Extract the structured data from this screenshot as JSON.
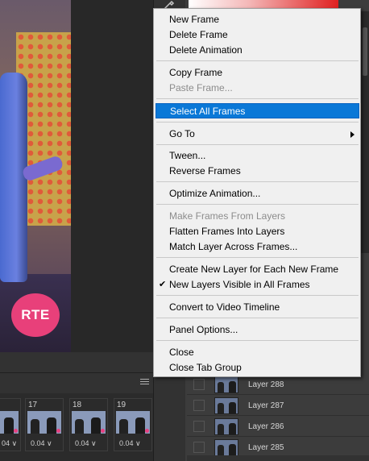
{
  "menu": {
    "items": [
      {
        "label": "New Frame"
      },
      {
        "label": "Delete Frame"
      },
      {
        "label": "Delete Animation"
      },
      {
        "label": "Copy Frame"
      },
      {
        "label": "Paste Frame..."
      },
      {
        "label": "Select All Frames"
      },
      {
        "label": "Go To"
      },
      {
        "label": "Tween..."
      },
      {
        "label": "Reverse Frames"
      },
      {
        "label": "Optimize Animation..."
      },
      {
        "label": "Make Frames From Layers"
      },
      {
        "label": "Flatten Frames Into Layers"
      },
      {
        "label": "Match Layer Across Frames..."
      },
      {
        "label": "Create New Layer for Each New Frame"
      },
      {
        "label": "New Layers Visible in All Frames"
      },
      {
        "label": "Convert to Video Timeline"
      },
      {
        "label": "Panel Options..."
      },
      {
        "label": "Close"
      },
      {
        "label": "Close Tab Group"
      }
    ],
    "check_glyph": "✔"
  },
  "canvas": {
    "logo_text": "RTE"
  },
  "layers": [
    {
      "name": "Layer 288"
    },
    {
      "name": "Layer 287"
    },
    {
      "name": "Layer 286"
    },
    {
      "name": "Layer 285"
    }
  ],
  "timeline": {
    "frames": [
      {
        "number": "",
        "delay": "04 ∨"
      },
      {
        "number": "17",
        "delay": "0.04 ∨"
      },
      {
        "number": "18",
        "delay": "0.04 ∨"
      },
      {
        "number": "19",
        "delay": "0.04 ∨"
      }
    ]
  },
  "colors": {
    "menu_background": "#f0f0f0",
    "menu_highlight": "#0a78d7",
    "logo_pink": "#e8407a"
  }
}
